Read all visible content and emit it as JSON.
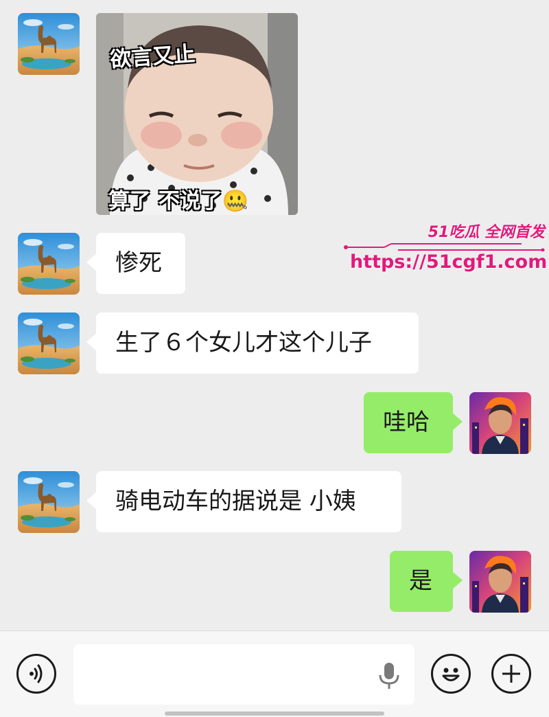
{
  "chat": {
    "sticker": {
      "caption_top": "欲言又止",
      "caption_bottom": "算了 不说了",
      "emoji": "🤐"
    },
    "messages": [
      {
        "side": "left",
        "text": "惨死"
      },
      {
        "side": "left",
        "text": "生了６个女儿才这个儿子"
      },
      {
        "side": "right",
        "text": "哇哈"
      },
      {
        "side": "left",
        "text": "骑电动车的据说是 小姨"
      },
      {
        "side": "right",
        "text": "是"
      }
    ]
  },
  "watermark": {
    "brand": "51吃瓜 全网首发",
    "url": "https://51cgf1.com"
  },
  "input_bar": {
    "value": "",
    "icons": [
      "voice-icon",
      "microphone-icon",
      "emoji-icon",
      "plus-icon"
    ]
  },
  "colors": {
    "background": "#ededed",
    "sent_bubble": "#95ec69",
    "received_bubble": "#ffffff",
    "watermark": "#e2197b"
  }
}
